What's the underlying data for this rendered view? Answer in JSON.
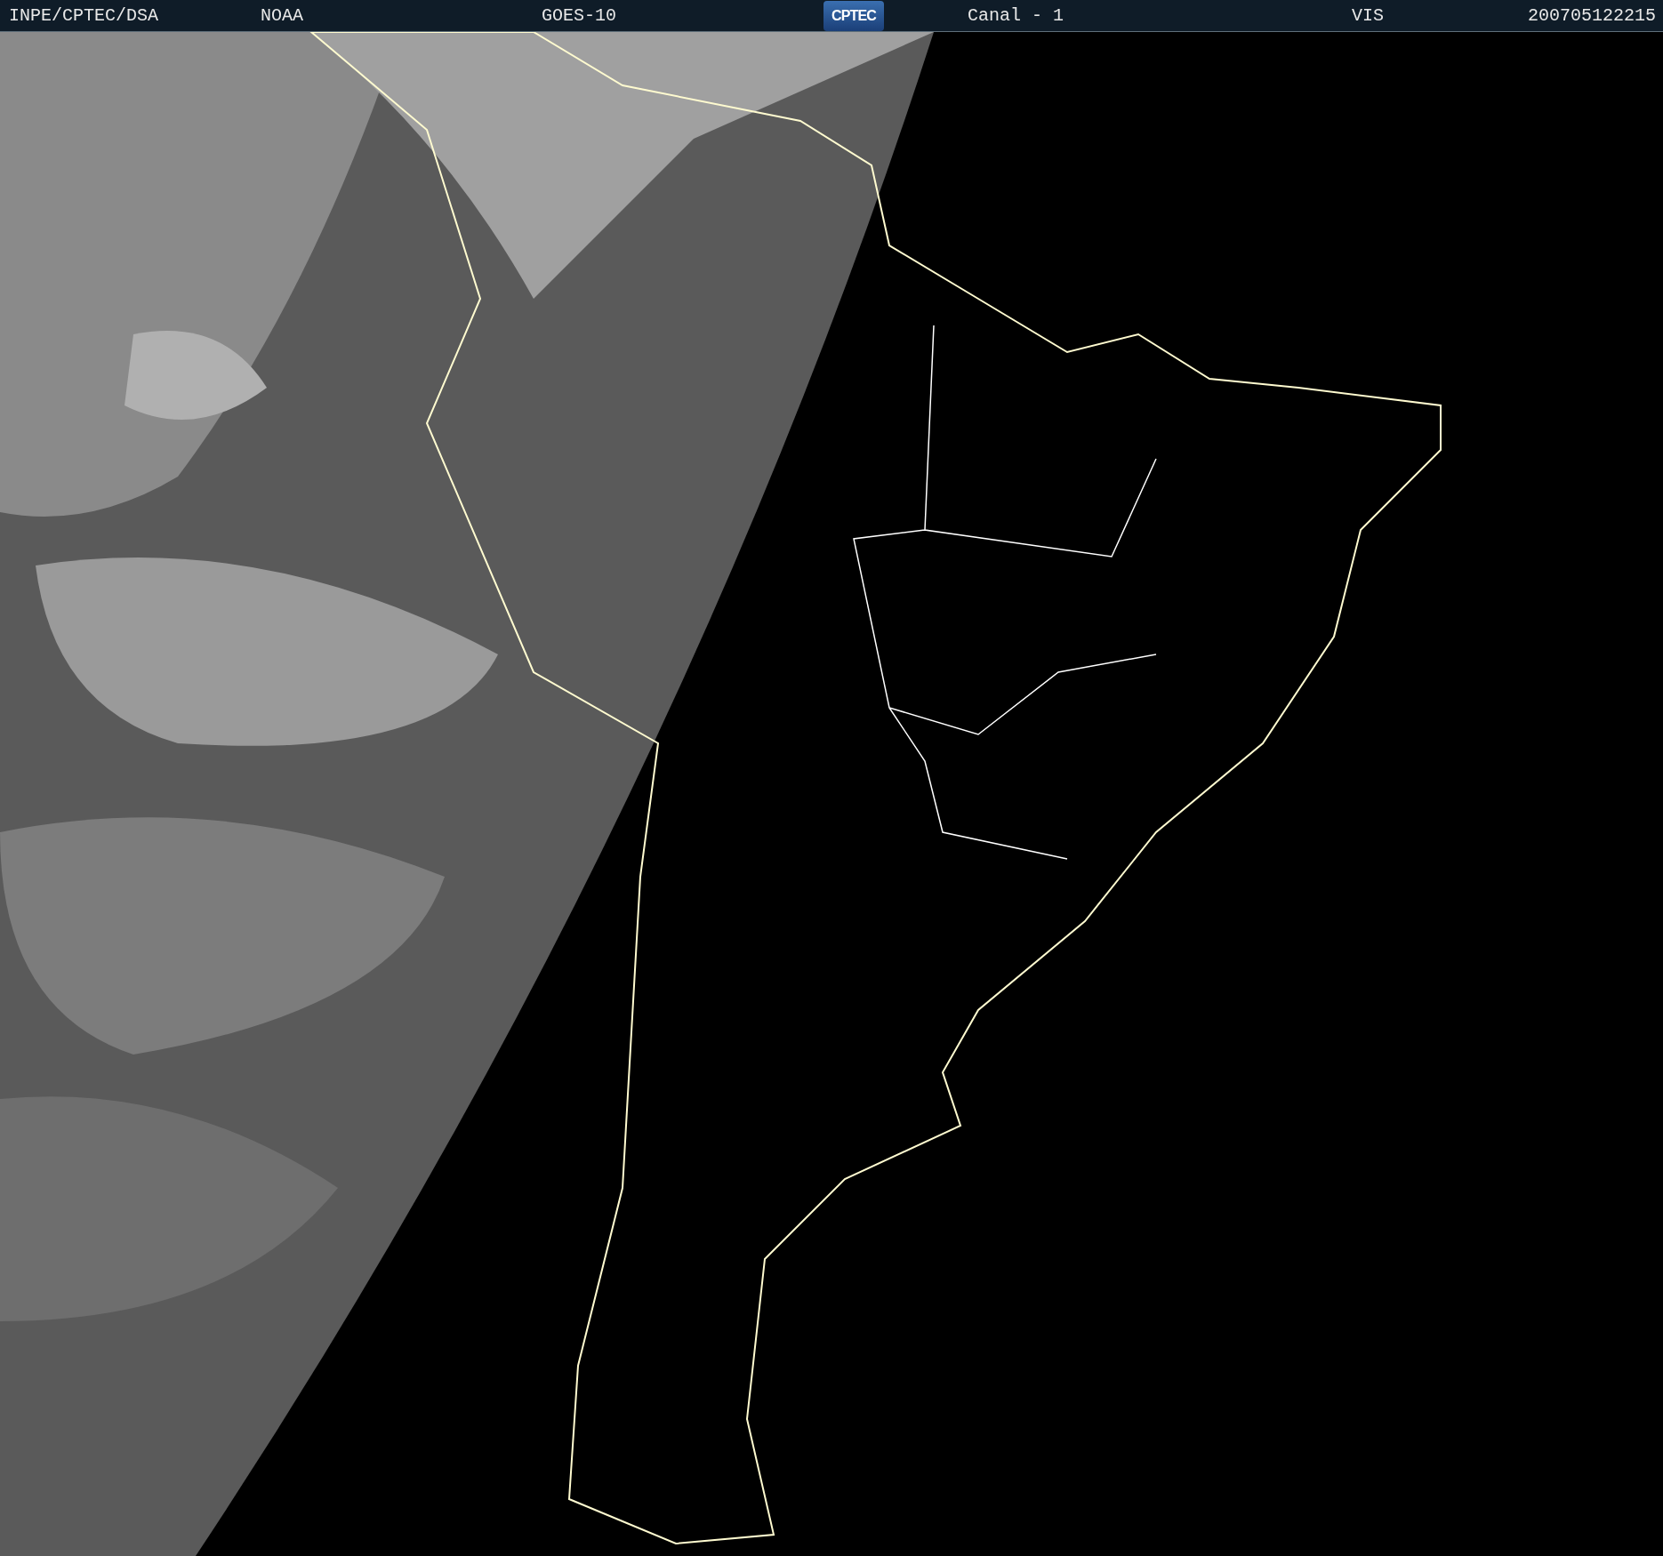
{
  "header": {
    "items": [
      {
        "kind": "text",
        "text": "INPE/CPTEC/DSA"
      },
      {
        "kind": "text",
        "text": "NOAA"
      },
      {
        "kind": "text",
        "text": "GOES-10"
      },
      {
        "kind": "logo",
        "text": "CPTEC"
      },
      {
        "kind": "text",
        "text": "Canal - 1"
      },
      {
        "kind": "text",
        "text": "VIS"
      },
      {
        "kind": "text",
        "text": "200705122215"
      }
    ]
  }
}
